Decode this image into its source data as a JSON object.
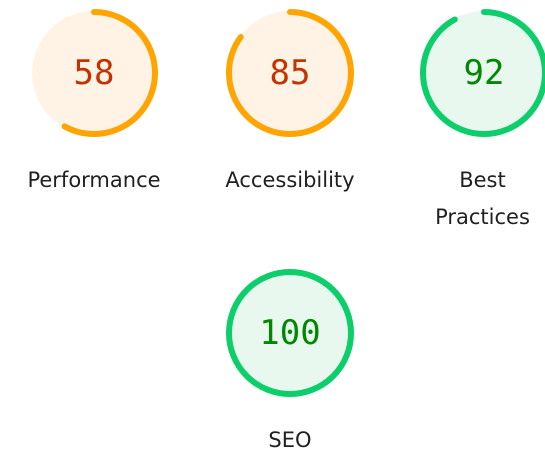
{
  "gauges": [
    {
      "name": "performance",
      "score": "58",
      "label": "Performance",
      "fraction": 0.58,
      "status": "average"
    },
    {
      "name": "accessibility",
      "score": "85",
      "label": "Accessibility",
      "fraction": 0.85,
      "status": "average"
    },
    {
      "name": "best-practices",
      "score": "92",
      "label": "Best Practices",
      "fraction": 0.92,
      "status": "pass"
    },
    {
      "name": "seo",
      "score": "100",
      "label": "SEO",
      "fraction": 1.0,
      "status": "pass"
    }
  ],
  "colors": {
    "average_arc": "#ffa400",
    "average_fill": "#fff3e6",
    "average_text": "#c33300",
    "pass_arc": "#0cce6b",
    "pass_fill": "#e8f8ef",
    "pass_text": "#008800"
  }
}
